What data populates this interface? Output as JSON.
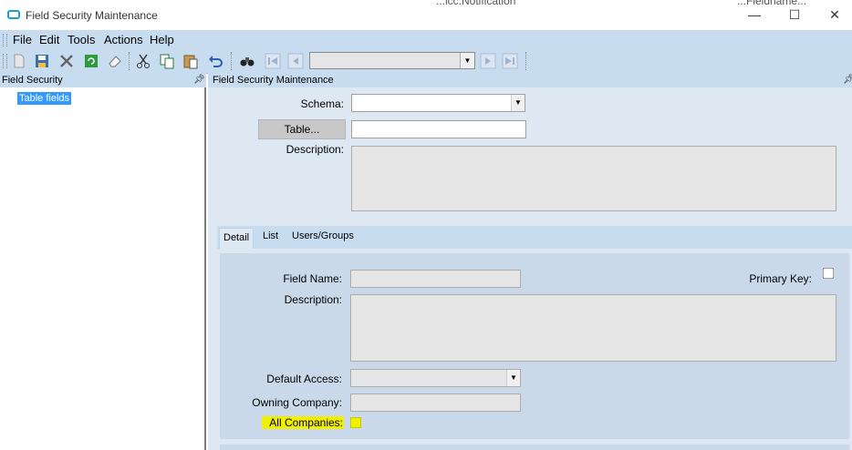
{
  "window": {
    "title": "Field Security Maintenance",
    "background_text_1": "...lcc.Notification",
    "background_text_2": "...Fieldname...",
    "minimize": "—",
    "maximize": "☐",
    "close": "✕"
  },
  "menu": [
    "File",
    "Edit",
    "Tools",
    "Actions",
    "Help"
  ],
  "toolbar": {
    "icons": [
      "new-icon",
      "save-icon",
      "delete-icon",
      "refresh-icon",
      "clear-icon",
      "cut-icon",
      "copy-icon",
      "paste-icon",
      "undo-icon",
      "search-icon",
      "first-record-icon",
      "prev-record-icon",
      "next-record-icon",
      "last-record-icon"
    ],
    "record_combo_value": ""
  },
  "left_panel": {
    "header": "Field Security",
    "tree_node": "Table fields"
  },
  "right_panel": {
    "header": "Field Security Maintenance",
    "schema_label": "Schema:",
    "schema_value": "",
    "table_button": "Table...",
    "table_value": "",
    "description_label": "Description:",
    "description_value": "",
    "tabs": [
      "Detail",
      "List",
      "Users/Groups"
    ],
    "detail": {
      "field_name_label": "Field Name:",
      "field_name_value": "",
      "primary_key_label": "Primary Key:",
      "description_label": "Description:",
      "description_value": "",
      "default_access_label": "Default Access:",
      "default_access_value": "",
      "owning_company_label": "Owning Company:",
      "owning_company_value": "",
      "all_companies_label": "All Companies:"
    }
  },
  "colors": {
    "menubar": "#c8dcf0",
    "pane": "#dde8f3",
    "highlight": "#f0f000",
    "tree_selection": "#3399ff"
  }
}
